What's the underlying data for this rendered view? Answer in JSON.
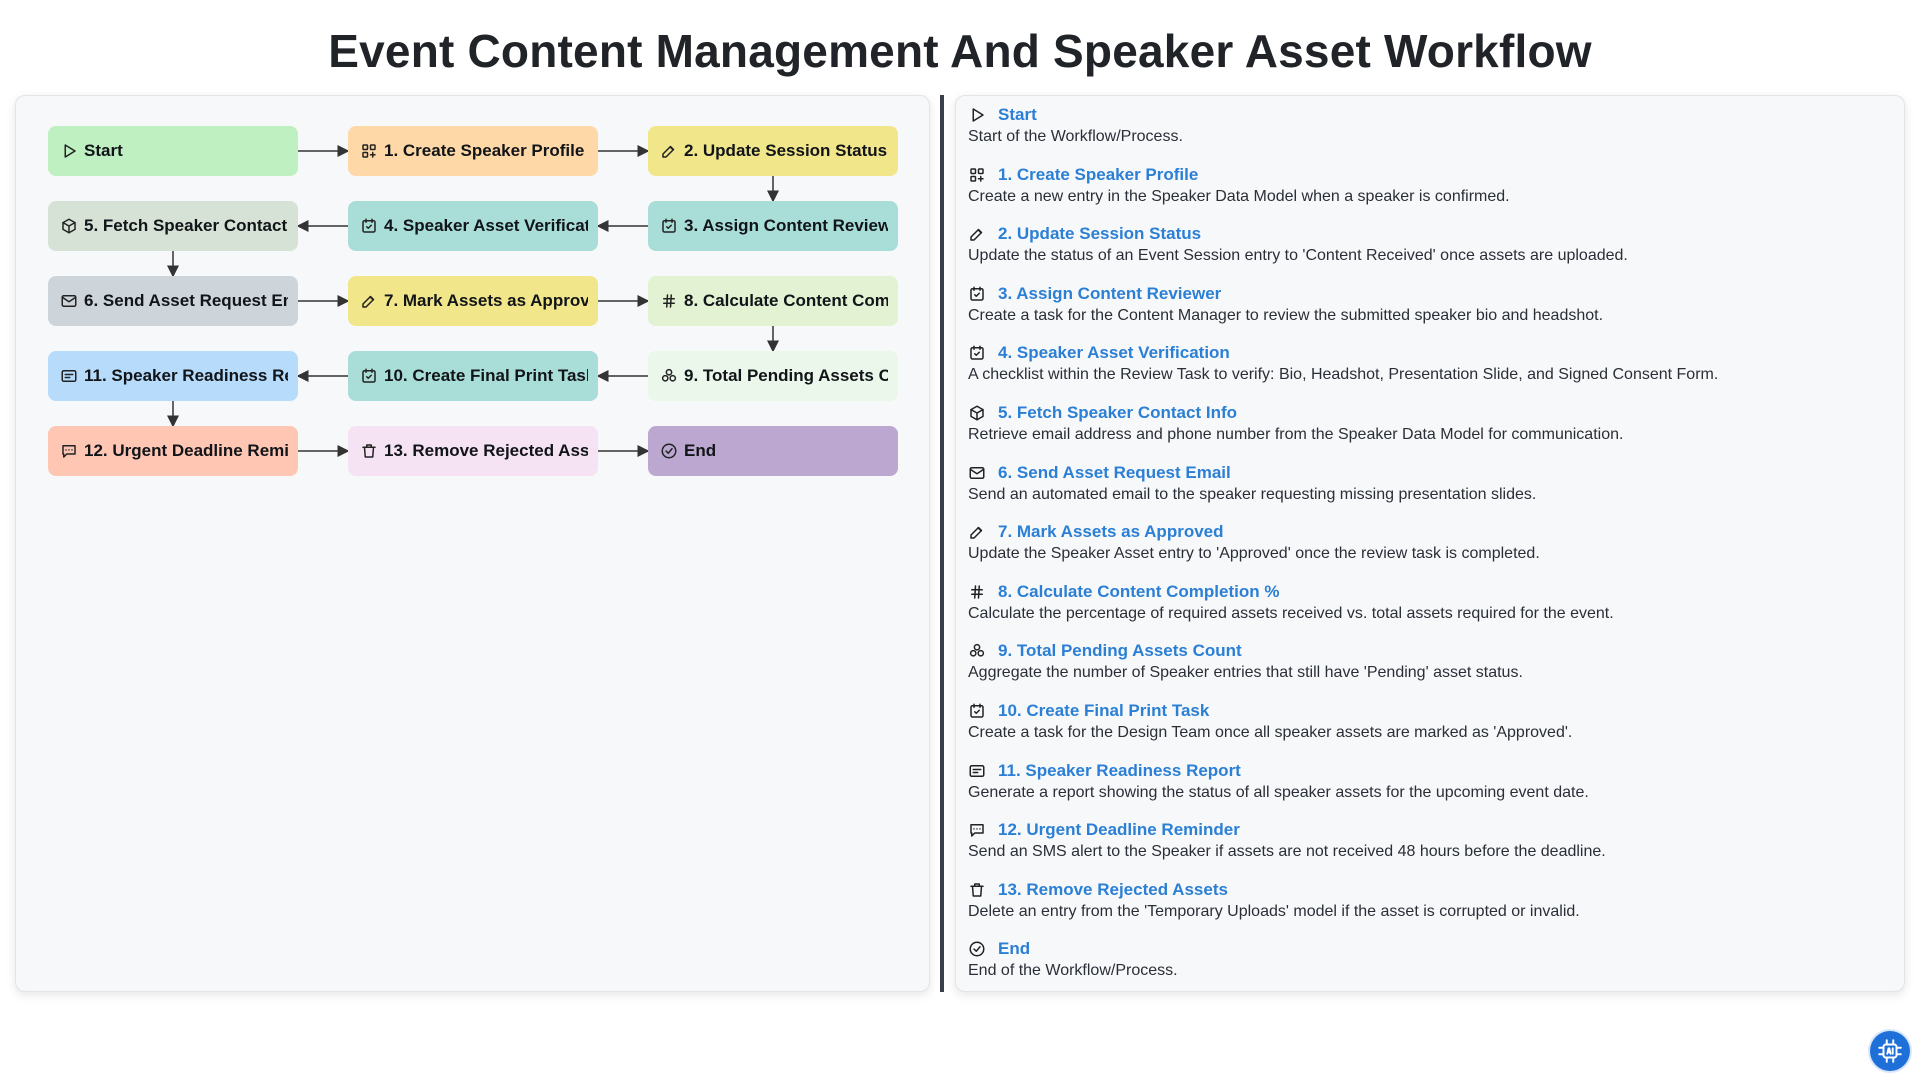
{
  "title": "Event Content Management And Speaker Asset Workflow",
  "colors": {
    "green": "#bff0c2",
    "orange": "#ffd8a8",
    "yellow": "#f2e68a",
    "teal": "#a9ddd8",
    "sage": "#d7e2d7",
    "slate": "#cdd5db",
    "lightgreen": "#e2f2d2",
    "mint": "#eaf7ea",
    "blue": "#b7dbfa",
    "salmon": "#ffc6b4",
    "pink": "#f5e2f2",
    "purple": "#bca7d1",
    "legend_title": "#2b7fd4"
  },
  "nodes": [
    {
      "id": "start",
      "label": "Start",
      "icon": "play-icon",
      "color": "green"
    },
    {
      "id": "n1",
      "label": "1. Create Speaker Profile",
      "icon": "grid-plus-icon",
      "color": "orange"
    },
    {
      "id": "n2",
      "label": "2. Update Session Status",
      "icon": "edit-icon",
      "color": "yellow"
    },
    {
      "id": "n3",
      "label": "3. Assign Content Reviewer",
      "icon": "checkbox-icon",
      "color": "teal"
    },
    {
      "id": "n4",
      "label": "4. Speaker Asset Verification",
      "icon": "checkbox-icon",
      "color": "teal"
    },
    {
      "id": "n5",
      "label": "5. Fetch Speaker Contact Info",
      "icon": "cube-icon",
      "color": "sage"
    },
    {
      "id": "n6",
      "label": "6. Send Asset Request Email",
      "icon": "mail-icon",
      "color": "slate"
    },
    {
      "id": "n7",
      "label": "7. Mark Assets as Approved",
      "icon": "edit-icon",
      "color": "yellow"
    },
    {
      "id": "n8",
      "label": "8. Calculate Content Completion %",
      "icon": "hash-icon",
      "color": "lightgreen"
    },
    {
      "id": "n9",
      "label": "9. Total Pending Assets Count",
      "icon": "stack-icon",
      "color": "mint"
    },
    {
      "id": "n10",
      "label": "10. Create Final Print Task",
      "icon": "checkbox-icon",
      "color": "teal"
    },
    {
      "id": "n11",
      "label": "11. Speaker Readiness Report",
      "icon": "report-icon",
      "color": "blue"
    },
    {
      "id": "n12",
      "label": "12. Urgent Deadline Reminder",
      "icon": "message-icon",
      "color": "salmon"
    },
    {
      "id": "n13",
      "label": "13. Remove Rejected Assets",
      "icon": "trash-icon",
      "color": "pink"
    },
    {
      "id": "end",
      "label": "End",
      "icon": "check-circle-icon",
      "color": "purple"
    }
  ],
  "edges": [
    [
      "start",
      "n1"
    ],
    [
      "n1",
      "n2"
    ],
    [
      "n2",
      "n3"
    ],
    [
      "n3",
      "n4"
    ],
    [
      "n4",
      "n5"
    ],
    [
      "n5",
      "n6"
    ],
    [
      "n6",
      "n7"
    ],
    [
      "n7",
      "n8"
    ],
    [
      "n8",
      "n9"
    ],
    [
      "n9",
      "n10"
    ],
    [
      "n10",
      "n11"
    ],
    [
      "n11",
      "n12"
    ],
    [
      "n12",
      "n13"
    ],
    [
      "n13",
      "end"
    ]
  ],
  "legend": [
    {
      "icon": "play-icon",
      "title": "Start",
      "desc": "Start of the Workflow/Process."
    },
    {
      "icon": "grid-plus-icon",
      "title": "1. Create Speaker Profile",
      "desc": "Create a new entry in the Speaker Data Model when a speaker is confirmed."
    },
    {
      "icon": "edit-icon",
      "title": "2. Update Session Status",
      "desc": "Update the status of an Event Session entry to 'Content Received' once assets are uploaded."
    },
    {
      "icon": "checkbox-icon",
      "title": "3. Assign Content Reviewer",
      "desc": "Create a task for the Content Manager to review the submitted speaker bio and headshot."
    },
    {
      "icon": "checkbox-icon",
      "title": "4. Speaker Asset Verification",
      "desc": "A checklist within the Review Task to verify: Bio, Headshot, Presentation Slide, and Signed Consent Form."
    },
    {
      "icon": "cube-icon",
      "title": "5. Fetch Speaker Contact Info",
      "desc": "Retrieve email address and phone number from the Speaker Data Model for communication."
    },
    {
      "icon": "mail-icon",
      "title": "6. Send Asset Request Email",
      "desc": "Send an automated email to the speaker requesting missing presentation slides."
    },
    {
      "icon": "edit-icon",
      "title": "7. Mark Assets as Approved",
      "desc": "Update the Speaker Asset entry to 'Approved' once the review task is completed."
    },
    {
      "icon": "hash-icon",
      "title": "8. Calculate Content Completion %",
      "desc": "Calculate the percentage of required assets received vs. total assets required for the event."
    },
    {
      "icon": "stack-icon",
      "title": "9. Total Pending Assets Count",
      "desc": "Aggregate the number of Speaker entries that still have 'Pending' asset status."
    },
    {
      "icon": "checkbox-icon",
      "title": "10. Create Final Print Task",
      "desc": "Create a task for the Design Team once all speaker assets are marked as 'Approved'."
    },
    {
      "icon": "report-icon",
      "title": "11. Speaker Readiness Report",
      "desc": "Generate a report showing the status of all speaker assets for the upcoming event date."
    },
    {
      "icon": "message-icon",
      "title": "12. Urgent Deadline Reminder",
      "desc": "Send an SMS alert to the Speaker if assets are not received 48 hours before the deadline."
    },
    {
      "icon": "trash-icon",
      "title": "13. Remove Rejected Assets",
      "desc": "Delete an entry from the 'Temporary Uploads' model if the asset is corrupted or invalid."
    },
    {
      "icon": "check-circle-icon",
      "title": "End",
      "desc": "End of the Workflow/Process."
    }
  ],
  "badge_icon": "ai-chip-icon"
}
